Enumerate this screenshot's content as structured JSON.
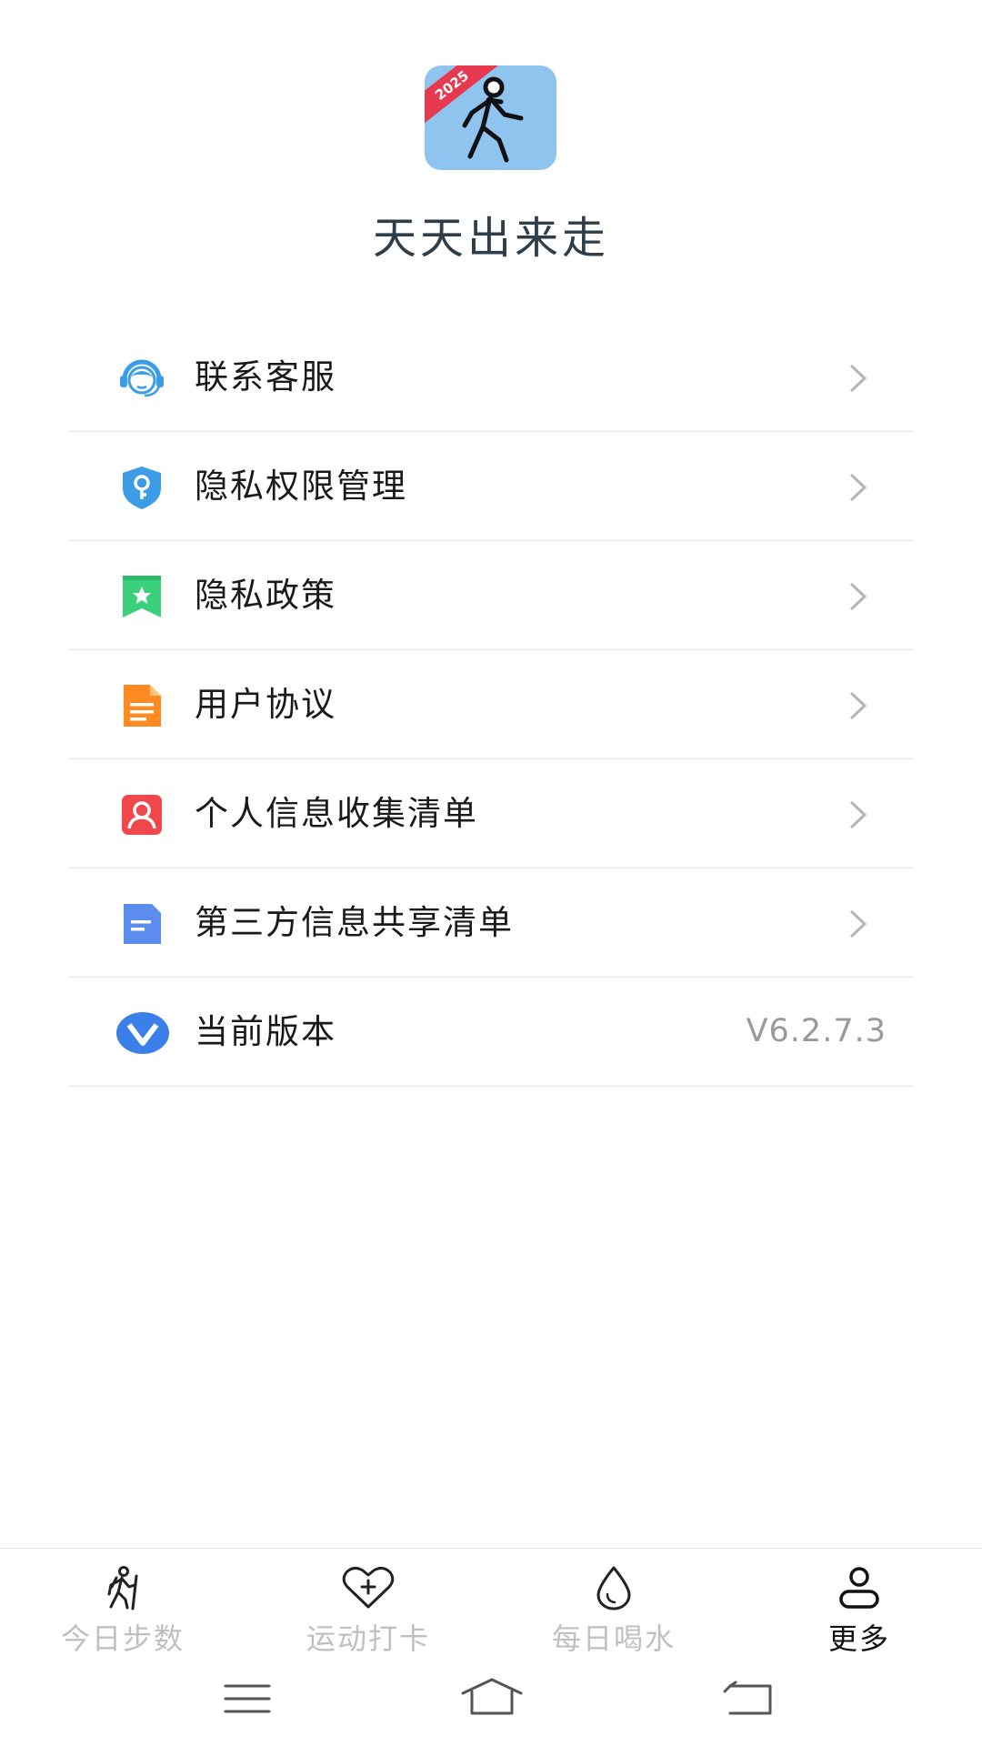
{
  "app": {
    "title": "天天出来走",
    "icon_badge": "2025",
    "icon_name": "walking-person-icon"
  },
  "menu": [
    {
      "label": "联系客服",
      "icon": "customer-service-icon",
      "color": "#3a9de6",
      "chevron": true
    },
    {
      "label": "隐私权限管理",
      "icon": "shield-key-icon",
      "color": "#3a9de6",
      "chevron": true
    },
    {
      "label": "隐私政策",
      "icon": "bookmark-star-icon",
      "color": "#3bd07b",
      "chevron": true
    },
    {
      "label": "用户协议",
      "icon": "document-icon",
      "color": "#ff8a1f",
      "chevron": true
    },
    {
      "label": "个人信息收集清单",
      "icon": "person-card-icon",
      "color": "#f0474a",
      "chevron": true
    },
    {
      "label": "第三方信息共享清单",
      "icon": "list-doc-icon",
      "color": "#5b8def",
      "chevron": true
    },
    {
      "label": "当前版本",
      "icon": "version-icon",
      "color": "#3a80e8",
      "value": "V6.2.7.3"
    }
  ],
  "tabs": [
    {
      "label": "今日步数",
      "icon": "hiker-icon",
      "active": false
    },
    {
      "label": "运动打卡",
      "icon": "heart-plus-icon",
      "active": false
    },
    {
      "label": "每日喝水",
      "icon": "water-drop-icon",
      "active": false
    },
    {
      "label": "更多",
      "icon": "user-icon",
      "active": true
    }
  ],
  "colors": {
    "title": "#2e3e4a",
    "icon_bg": "#8ec4ee",
    "badge": "#e63950",
    "tab_inactive": "#c0c0c0",
    "tab_active": "#111111"
  }
}
